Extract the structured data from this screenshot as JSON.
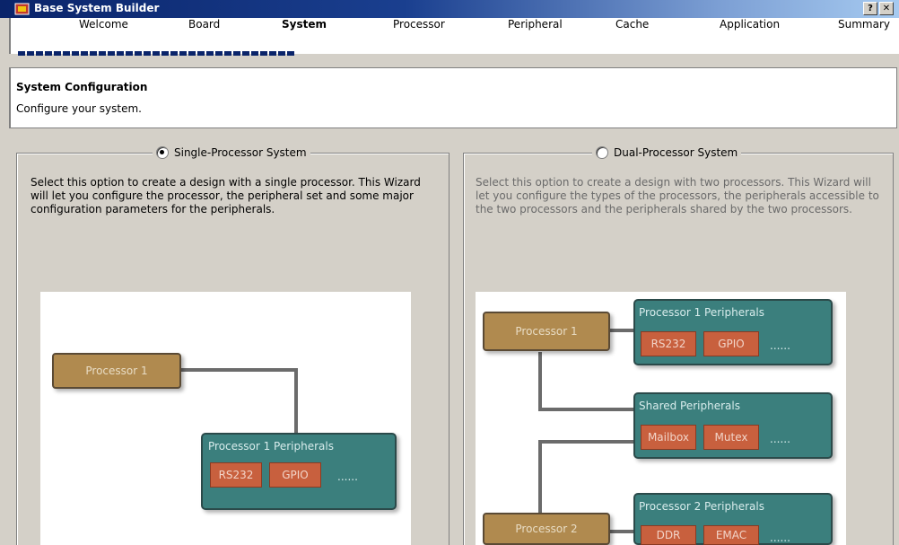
{
  "window": {
    "title": "Base System Builder",
    "help_button": "?",
    "close_button": "✕"
  },
  "steps": [
    {
      "label": "Welcome"
    },
    {
      "label": "Board"
    },
    {
      "label": "System"
    },
    {
      "label": "Processor"
    },
    {
      "label": "Peripheral"
    },
    {
      "label": "Cache"
    },
    {
      "label": "Application"
    },
    {
      "label": "Summary"
    }
  ],
  "active_step": "System",
  "header": {
    "title": "System Configuration",
    "description": "Configure your system."
  },
  "options": [
    {
      "label": "Single-Processor System",
      "selected": true,
      "description": "Select this option to create a design with a single processor. This Wizard will let you configure the processor, the peripheral set and some major configuration parameters for the peripherals.",
      "diagram": {
        "processor": "Processor 1",
        "peripherals_title": "Processor 1 Peripherals",
        "chips": [
          "RS232",
          "GPIO"
        ],
        "more": "......"
      }
    },
    {
      "label": "Dual-Processor System",
      "selected": false,
      "description": "Select this option to create a design with two processors. This Wizard will let you configure the types of the processors, the peripherals accessible to the two processors and the peripherals shared by the two processors.",
      "diagram": {
        "processor1": "Processor 1",
        "processor2": "Processor 2",
        "p1_peripherals_title": "Processor 1 Peripherals",
        "p1_chips": [
          "RS232",
          "GPIO"
        ],
        "shared_title": "Shared Peripherals",
        "shared_chips": [
          "Mailbox",
          "Mutex"
        ],
        "p2_peripherals_title": "Processor 2 Peripherals",
        "p2_chips": [
          "DDR",
          "EMAC"
        ],
        "more": "......"
      }
    }
  ],
  "colors": {
    "titlebar_start": "#0a246a",
    "titlebar_end": "#a6caf0",
    "processor_box": "#b08a4f",
    "peripheral_box": "#3b7f7d",
    "chip": "#c8603e",
    "dialog_bg": "#d4d0c8"
  }
}
